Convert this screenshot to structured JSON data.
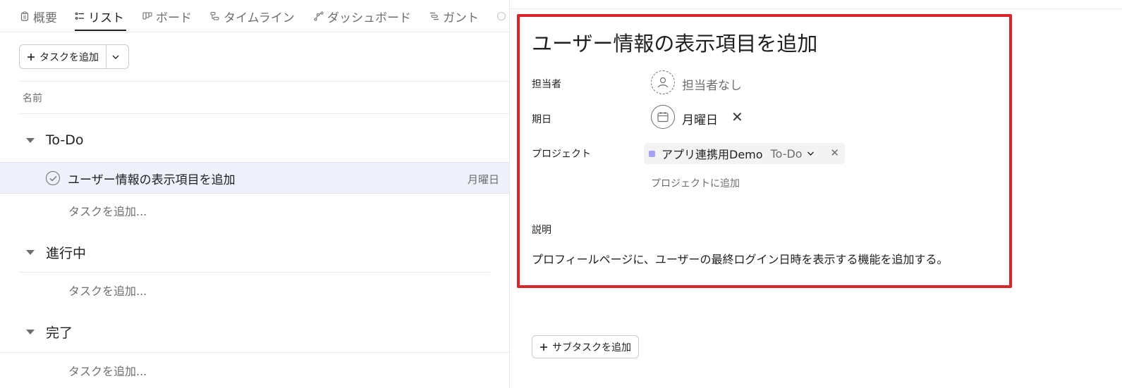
{
  "tabs": [
    {
      "label": "概要",
      "icon": "clipboard-icon"
    },
    {
      "label": "リスト",
      "icon": "list-icon"
    },
    {
      "label": "ボード",
      "icon": "board-icon"
    },
    {
      "label": "タイムライン",
      "icon": "timeline-icon"
    },
    {
      "label": "ダッシュボード",
      "icon": "dashboard-icon"
    },
    {
      "label": "ガント",
      "icon": "gantt-icon"
    }
  ],
  "toolbar": {
    "add_task_label": "タスクを追加"
  },
  "list": {
    "column_name": "名前",
    "sections": [
      {
        "title": "To-Do",
        "add_label": "タスクを追加..."
      },
      {
        "title": "進行中",
        "add_label": "タスクを追加..."
      },
      {
        "title": "完了",
        "add_label": "タスクを追加..."
      }
    ],
    "task": {
      "name": "ユーザー情報の表示項目を追加",
      "due": "月曜日"
    }
  },
  "detail": {
    "title": "ユーザー情報の表示項目を追加",
    "assignee_label": "担当者",
    "assignee_value": "担当者なし",
    "due_label": "期日",
    "due_value": "月曜日",
    "due_clear": "✕",
    "project_label": "プロジェクト",
    "project_name": "アプリ連携用Demo",
    "project_section": "To-Do",
    "project_remove": "✕",
    "add_to_project": "プロジェクトに追加",
    "description_label": "説明",
    "description": "プロフィールページに、ユーザーの最終ログイン日時を表示する機能を追加する。",
    "add_subtask_label": "サブタスクを追加"
  },
  "colors": {
    "highlight_border": "#d9262b",
    "selected_row": "#eef0fa",
    "project_dot": "#a7a2f2"
  }
}
